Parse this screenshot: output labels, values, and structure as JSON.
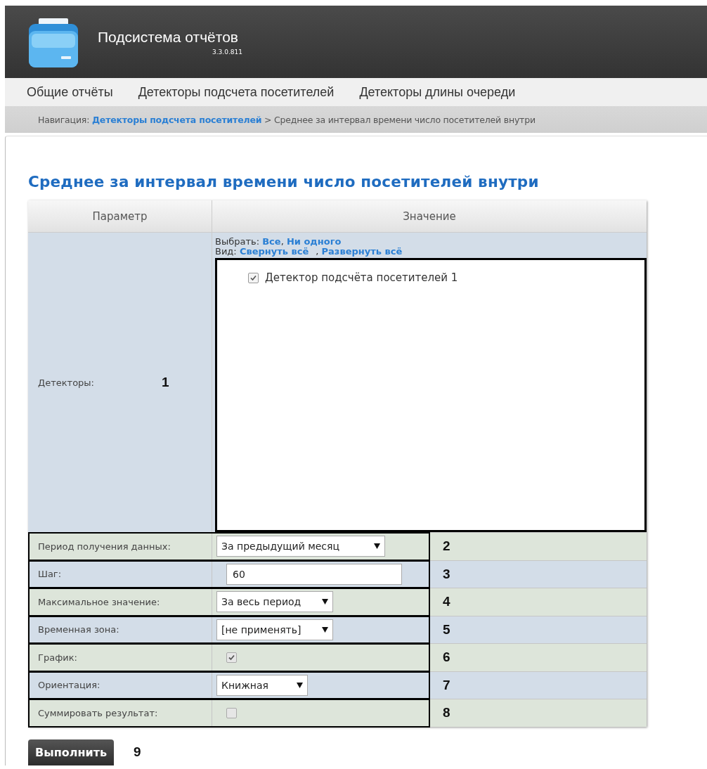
{
  "app": {
    "title": "Подсистема отчётов",
    "version": "3.3.0.811"
  },
  "menu": [
    {
      "label": "Общие отчёты"
    },
    {
      "label": "Детекторы подсчета посетителей"
    },
    {
      "label": "Детекторы длины очереди"
    }
  ],
  "breadcrumb": {
    "prefix": "Навигация:",
    "link": "Детекторы подсчета посетителей",
    "rest": "> Среднее за интервал времени число посетителей внутри"
  },
  "page_title": "Среднее за интервал времени число посетителей внутри",
  "table": {
    "columns": [
      "Параметр",
      "Значение"
    ],
    "detectors": {
      "label": "Детекторы:",
      "marker": "1",
      "select_label": "Выбрать:",
      "select_links": [
        "Все",
        "Ни одного"
      ],
      "link_separator": ",",
      "view_label": "Вид:",
      "view_links": [
        "Свернуть всё",
        "Развернуть всё"
      ],
      "items": [
        {
          "label": "Детектор подсчёта посетителей 1",
          "checked": true
        }
      ]
    },
    "rows": [
      {
        "kind": "select",
        "label": "Период получения данных:",
        "value": "За предыдущий месяц",
        "marker": "2"
      },
      {
        "kind": "input",
        "label": "Шаг:",
        "value": "60",
        "marker": "3"
      },
      {
        "kind": "select",
        "label": "Максимальное значение:",
        "value": "За весь период",
        "marker": "4"
      },
      {
        "kind": "select",
        "label": "Временная зона:",
        "value": "[не применять]",
        "marker": "5"
      },
      {
        "kind": "checkbox",
        "label": "График:",
        "checked": true,
        "marker": "6"
      },
      {
        "kind": "select",
        "label": "Ориентация:",
        "value": "Книжная",
        "marker": "7"
      },
      {
        "kind": "checkbox",
        "label": "Суммировать результат:",
        "checked": false,
        "marker": "8"
      }
    ]
  },
  "run_button": {
    "label": "Выполнить",
    "marker": "9"
  }
}
